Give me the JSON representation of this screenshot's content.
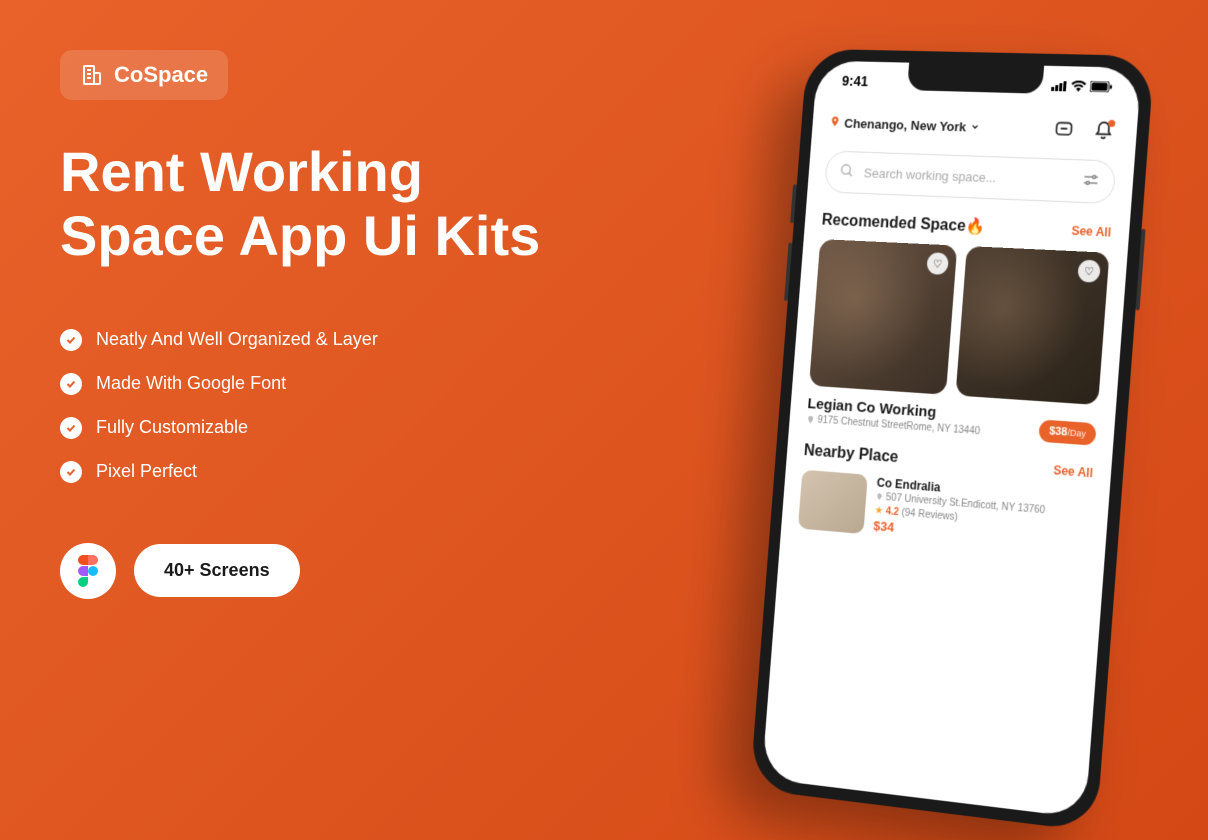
{
  "brand": {
    "name": "CoSpace"
  },
  "headline": "Rent Working Space App Ui Kits",
  "features": [
    "Neatly And Well Organized & Layer",
    "Made With Google Font",
    "Fully Customizable",
    "Pixel Perfect"
  ],
  "screens_badge": "40+ Screens",
  "phone": {
    "status_time": "9:41",
    "location": "Chenango, New York",
    "search_placeholder": "Search working space...",
    "recommended": {
      "title": "Recomended Space🔥",
      "see_all": "See All",
      "item": {
        "name": "Legian Co Working",
        "address": "9175 Chestnut StreetRome, NY 13440",
        "price": "$38",
        "per": "/Day"
      }
    },
    "nearby": {
      "title": "Nearby Place",
      "see_all": "See All",
      "item": {
        "name": "Co Endralia",
        "address": "507 University St.Endicott, NY 13760",
        "rating": "4.2",
        "reviews": "(94 Reviews)",
        "price": "$34"
      }
    }
  }
}
